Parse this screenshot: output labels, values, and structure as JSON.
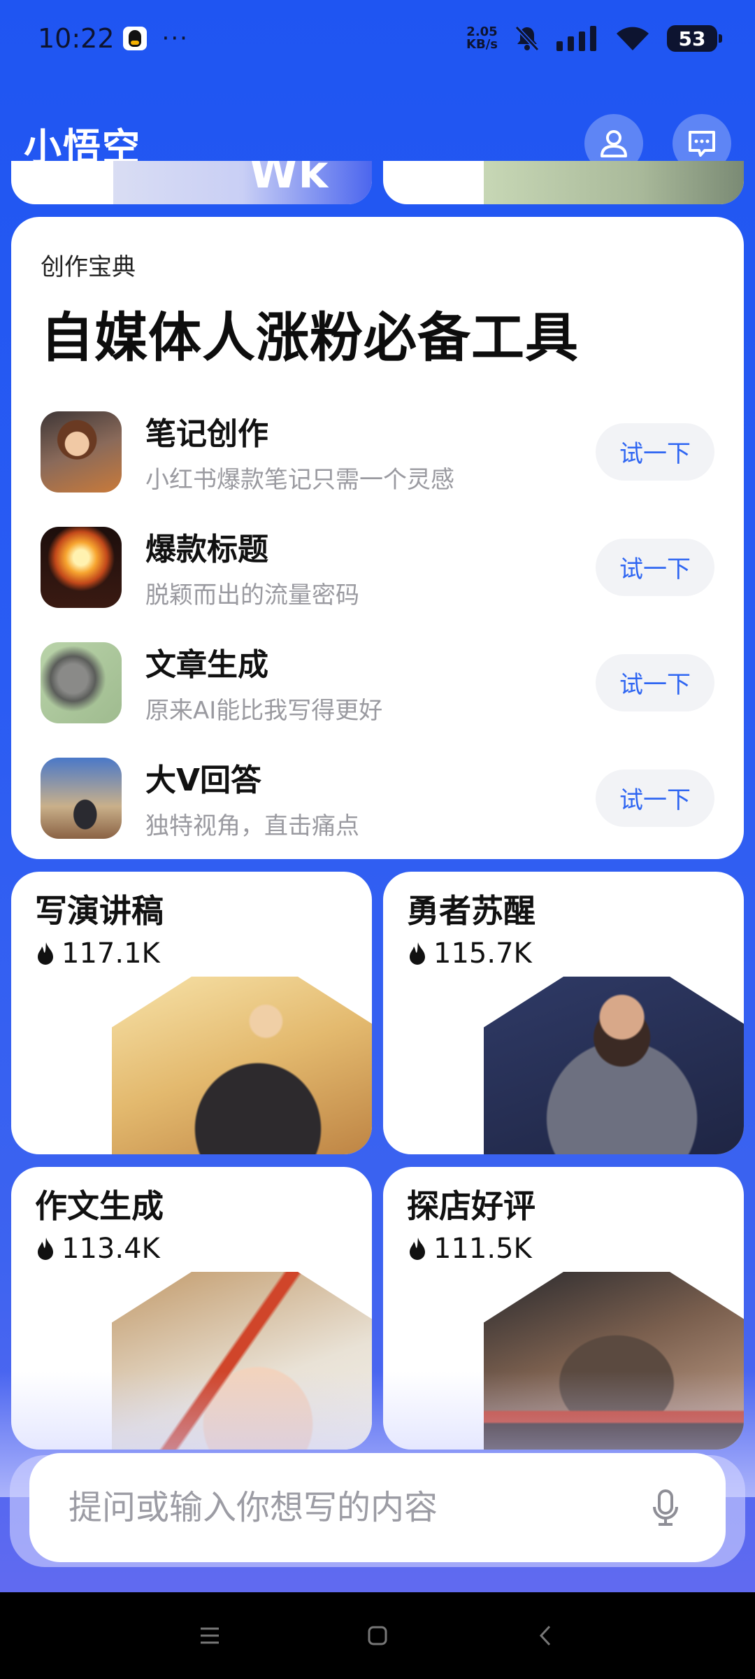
{
  "status_bar": {
    "time": "10:22",
    "more": "···",
    "speed_value": "2.05",
    "speed_unit": "KB/s",
    "battery": "53"
  },
  "header": {
    "title": "小悟空",
    "icons": [
      "user-icon",
      "feedback-icon"
    ]
  },
  "peek": {
    "left_text": "Wk"
  },
  "main_card": {
    "kicker": "创作宝典",
    "heading": "自媒体人涨粉必备工具",
    "tools": [
      {
        "name": "笔记创作",
        "desc": "小红书爆款笔记只需一个灵感",
        "button": "试一下"
      },
      {
        "name": "爆款标题",
        "desc": "脱颖而出的流量密码",
        "button": "试一下"
      },
      {
        "name": "文章生成",
        "desc": "原来AI能比我写得更好",
        "button": "试一下"
      },
      {
        "name": "大V回答",
        "desc": "独特视角，直击痛点",
        "button": "试一下"
      }
    ]
  },
  "grid": [
    {
      "title": "写演讲稿",
      "count": "117.1K"
    },
    {
      "title": "勇者苏醒",
      "count": "115.7K"
    },
    {
      "title": "作文生成",
      "count": "113.4K"
    },
    {
      "title": "探店好评",
      "count": "111.5K"
    }
  ],
  "input": {
    "placeholder": "提问或输入你想写的内容"
  },
  "colors": {
    "brand": "#2a5cf3",
    "button_text": "#2f66f2"
  }
}
